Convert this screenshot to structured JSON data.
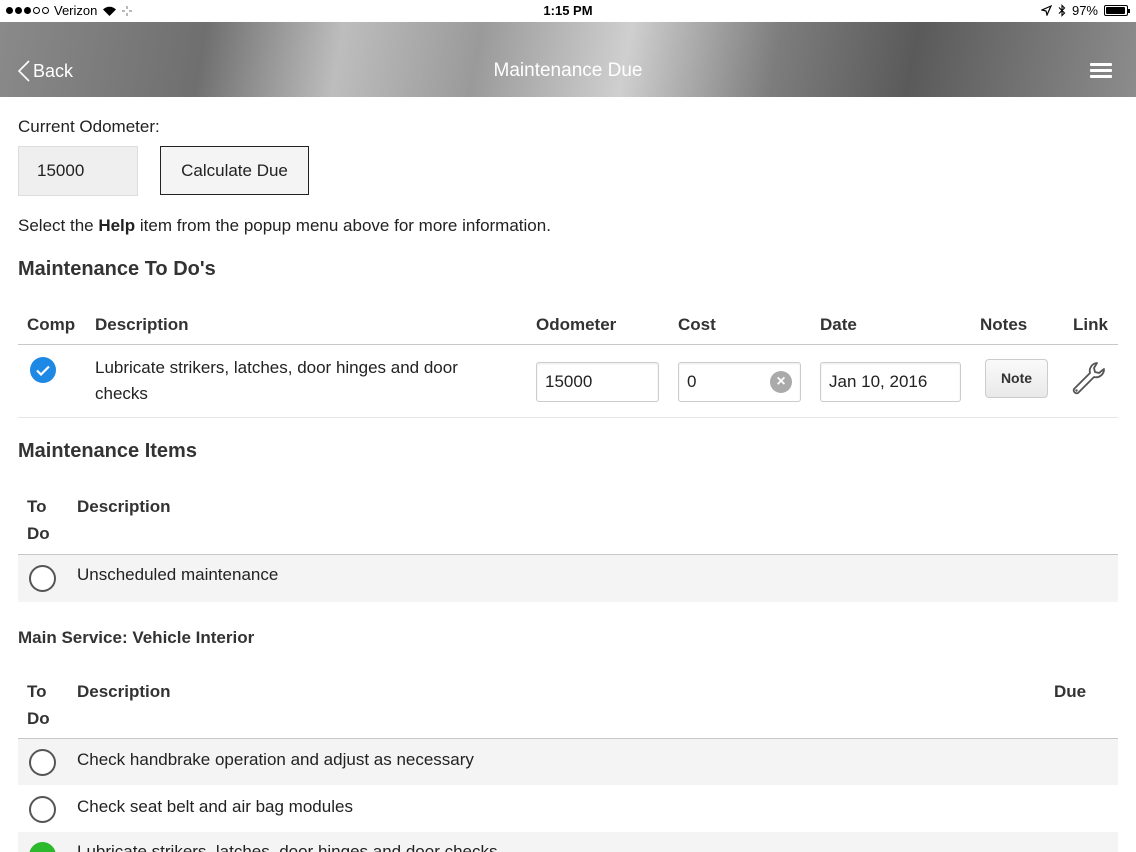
{
  "status": {
    "carrier": "Verizon",
    "time": "1:15 PM",
    "battery": "97%",
    "battery_level": 0.97
  },
  "nav": {
    "back_label": "Back",
    "title": "Maintenance Due"
  },
  "odometer": {
    "label": "Current Odometer:",
    "value": "15000",
    "calc_button": "Calculate Due"
  },
  "help": {
    "prefix": "Select the ",
    "bold": "Help",
    "suffix": " item from the popup menu above for more information."
  },
  "todos": {
    "title": "Maintenance To Do's",
    "headers": {
      "comp": "Comp",
      "description": "Description",
      "odometer": "Odometer",
      "cost": "Cost",
      "date": "Date",
      "notes": "Notes",
      "link": "Link"
    },
    "rows": [
      {
        "completed": true,
        "description": "Lubricate strikers, latches, door hinges and door checks",
        "odometer": "15000",
        "cost": "0",
        "date": "Jan 10, 2016",
        "note_button": "Note",
        "link_icon": "wrench-icon"
      }
    ]
  },
  "items": {
    "title": "Maintenance Items",
    "headers": {
      "todo_1": "To",
      "todo_2": "Do",
      "description": "Description"
    },
    "rows": [
      {
        "description": "Unscheduled maintenance",
        "selected": false
      }
    ]
  },
  "interior": {
    "title": "Main Service: Vehicle Interior",
    "headers": {
      "todo_1": "To",
      "todo_2": "Do",
      "description": "Description",
      "due": "Due"
    },
    "rows": [
      {
        "description": "Check handbrake operation and adjust as necessary",
        "selected": false
      },
      {
        "description": "Check seat belt and air bag modules",
        "selected": false
      },
      {
        "description": "Lubricate strikers, latches, door hinges and door checks",
        "selected": true
      }
    ]
  },
  "colors": {
    "accent_blue": "#1e88e5",
    "selected_green": "#2db92d"
  }
}
